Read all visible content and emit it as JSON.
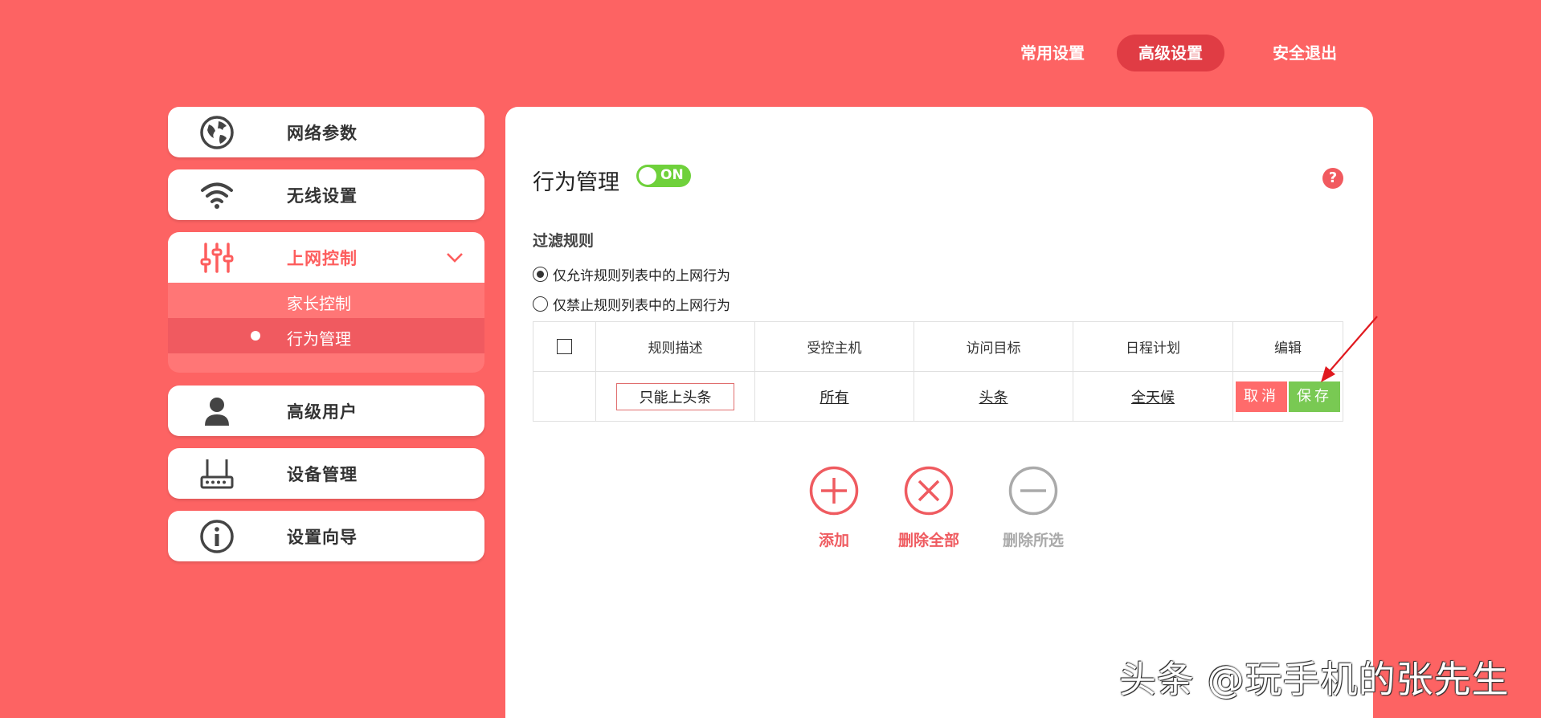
{
  "topnav": {
    "items": [
      {
        "label": "常用设置"
      },
      {
        "label": "高级设置"
      },
      {
        "label": "安全退出"
      }
    ]
  },
  "sidebar": {
    "items": [
      {
        "label": "网络参数",
        "icon": "globe-icon"
      },
      {
        "label": "无线设置",
        "icon": "wifi-icon"
      },
      {
        "label": "上网控制",
        "icon": "sliders-icon"
      },
      {
        "label": "高级用户",
        "icon": "user-icon"
      },
      {
        "label": "设备管理",
        "icon": "router-icon"
      },
      {
        "label": "设置向导",
        "icon": "info-icon"
      }
    ],
    "submenu": [
      {
        "label": "家长控制"
      },
      {
        "label": "行为管理"
      }
    ]
  },
  "main": {
    "title": "行为管理",
    "toggle_label": "ON",
    "help_label": "?",
    "section_title": "过滤规则",
    "radio_options": [
      {
        "label": "仅允许规则列表中的上网行为",
        "checked": true
      },
      {
        "label": "仅禁止规则列表中的上网行为",
        "checked": false
      }
    ],
    "table": {
      "headers": [
        "规则描述",
        "受控主机",
        "访问目标",
        "日程计划",
        "编辑"
      ],
      "row": {
        "description": "只能上头条",
        "host": "所有",
        "target": "头条",
        "schedule": "全天候",
        "cancel_label": "取消",
        "save_label": "保存"
      }
    },
    "actions": [
      {
        "label": "添加"
      },
      {
        "label": "删除全部"
      },
      {
        "label": "删除所选"
      }
    ]
  },
  "watermark": "头条 @玩手机的张先生",
  "colors": {
    "background": "#fd6363",
    "accent_red": "#f15a5f",
    "toggle_green": "#6fd13b",
    "save_green": "#79c953"
  }
}
